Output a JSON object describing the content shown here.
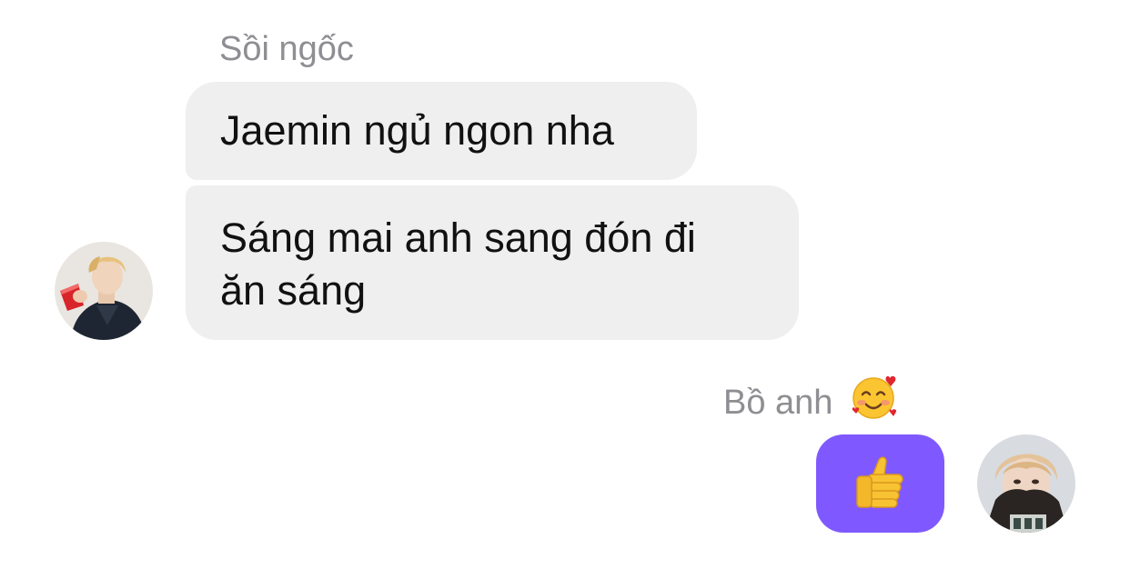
{
  "conversation": {
    "incoming": {
      "sender_name": "Sồi ngốc",
      "messages": [
        {
          "text": "Jaemin ngủ ngon nha"
        },
        {
          "text_line1": "Sáng mai anh sang đón đi",
          "text_line2": "ăn sáng"
        }
      ],
      "avatar_icon": "user-photo-avatar"
    },
    "outgoing": {
      "sender_name": "Bồ anh",
      "sender_emoji_icon": "smiling-face-with-hearts-icon",
      "sticker_icon": "thumbs-up-icon",
      "sticker_color": "#7f59ff",
      "avatar_icon": "user-photo-avatar"
    }
  }
}
